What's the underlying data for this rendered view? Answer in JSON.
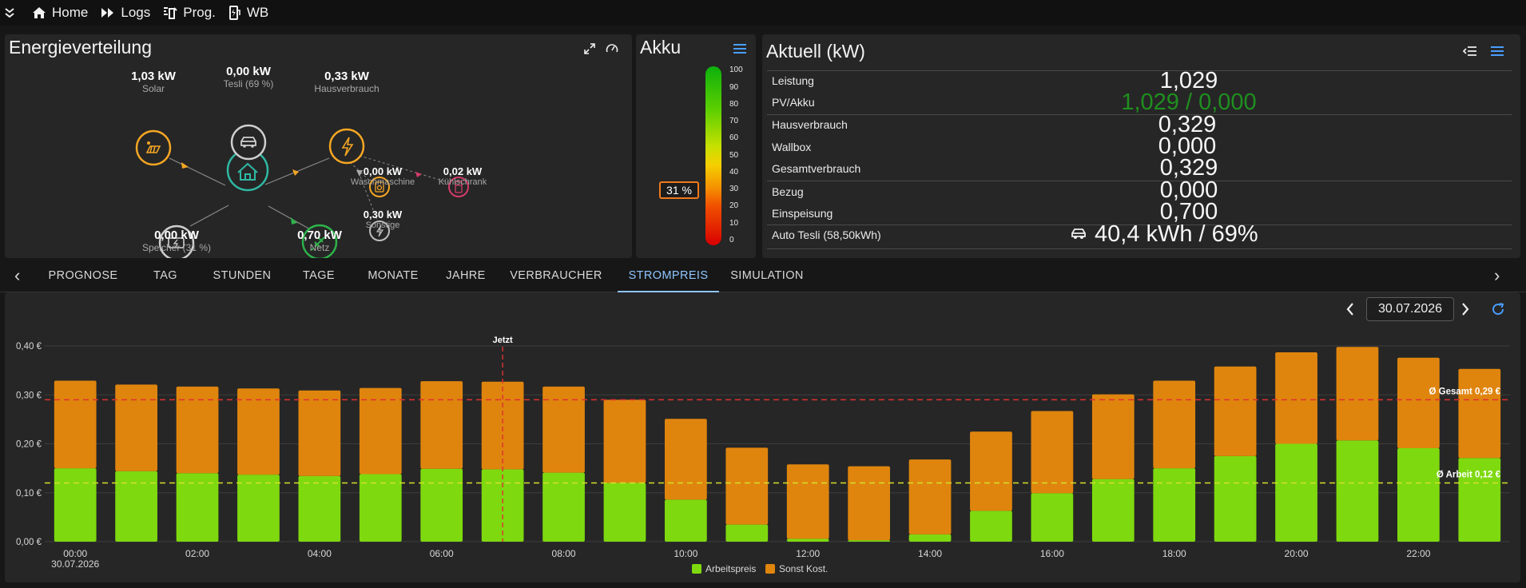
{
  "nav": {
    "items": [
      {
        "label": "Home",
        "icon": "home-icon"
      },
      {
        "label": "Logs",
        "icon": "fast-forward-icon"
      },
      {
        "label": "Prog.",
        "icon": "program-icon"
      },
      {
        "label": "WB",
        "icon": "wallbox-icon"
      }
    ]
  },
  "energy": {
    "title": "Energieverteilung",
    "solar": {
      "value": "1,03 kW",
      "label": "Solar"
    },
    "tesli": {
      "value": "0,00 kW",
      "label": "Tesli (69 %)"
    },
    "haus": {
      "value": "0,33 kW",
      "label": "Hausverbrauch"
    },
    "speicher": {
      "value": "0,00 kW",
      "label": "Speicher (31 %)"
    },
    "netz": {
      "value": "0,70 kW",
      "label": "Netz"
    },
    "wasch": {
      "value": "0,00 kW",
      "label": "Waschmaschine"
    },
    "kuehl": {
      "value": "0,02 kW",
      "label": "Kühlschrank"
    },
    "sonstige": {
      "value": "0,30 kW",
      "label": "Sonstige"
    }
  },
  "akku": {
    "title": "Akku",
    "level": 31,
    "level_label": "31 %",
    "scale": [
      "100",
      "90",
      "80",
      "70",
      "60",
      "50",
      "40",
      "30",
      "20",
      "10",
      "0"
    ]
  },
  "aktuell": {
    "title": "Aktuell (kW)",
    "rows": [
      {
        "label": "Leistung",
        "value": "1,029"
      },
      {
        "label": "PV/Akku",
        "value": "1,029 / 0,000"
      },
      {
        "label": "Hausverbrauch",
        "value": "0,329"
      },
      {
        "label": "Wallbox",
        "value": "0,000"
      },
      {
        "label": "Gesamtverbrauch",
        "value": "0,329"
      },
      {
        "label": "Bezug",
        "value": "0,000"
      },
      {
        "label": "Einspeisung",
        "value": "0,700"
      },
      {
        "label": "Auto Tesli (58,50kWh)",
        "value": "40,4 kWh / 69%"
      }
    ],
    "colors": {
      "pv": "#1f8f1f"
    }
  },
  "tabs": {
    "items": [
      "PROGNOSE",
      "TAG",
      "STUNDEN",
      "TAGE",
      "MONATE",
      "JAHRE",
      "VERBRAUCHER",
      "STROMPREIS",
      "SIMULATION"
    ],
    "active": "STROMPREIS"
  },
  "chart_toolbar": {
    "date": "30.07.2026"
  },
  "chart_data": {
    "type": "bar",
    "stacked": true,
    "categories": [
      "00:00",
      "01:00",
      "02:00",
      "03:00",
      "04:00",
      "05:00",
      "06:00",
      "07:00",
      "08:00",
      "09:00",
      "10:00",
      "11:00",
      "12:00",
      "13:00",
      "14:00",
      "15:00",
      "16:00",
      "17:00",
      "18:00",
      "19:00",
      "20:00",
      "21:00",
      "22:00",
      "23:00"
    ],
    "xtick_labels": [
      "00:00",
      "",
      "02:00",
      "",
      "04:00",
      "",
      "06:00",
      "",
      "08:00",
      "",
      "10:00",
      "",
      "12:00",
      "",
      "14:00",
      "",
      "16:00",
      "",
      "18:00",
      "",
      "20:00",
      "",
      "22:00",
      ""
    ],
    "x_date_label": "30.07.2026",
    "series": [
      {
        "name": "Arbeitspreis",
        "color": "#7ed90f",
        "values": [
          0.15,
          0.144,
          0.14,
          0.137,
          0.134,
          0.138,
          0.149,
          0.148,
          0.141,
          0.12,
          0.086,
          0.035,
          0.006,
          0.003,
          0.015,
          0.063,
          0.099,
          0.128,
          0.15,
          0.175,
          0.2,
          0.207,
          0.191,
          0.171
        ]
      },
      {
        "name": "Sonst Kost.",
        "color": "#df850e",
        "values": [
          0.179,
          0.177,
          0.177,
          0.176,
          0.175,
          0.176,
          0.179,
          0.179,
          0.176,
          0.17,
          0.165,
          0.157,
          0.152,
          0.151,
          0.153,
          0.162,
          0.168,
          0.173,
          0.179,
          0.183,
          0.187,
          0.191,
          0.185,
          0.182
        ]
      }
    ],
    "ylim": [
      0,
      0.4
    ],
    "yticks": [
      "0,00 €",
      "0,10 €",
      "0,20 €",
      "0,30 €",
      "0,40 €"
    ],
    "lines": [
      {
        "label": "Ø Gesamt 0,29 €",
        "value": 0.29,
        "color": "#e03030"
      },
      {
        "label": "Ø Arbeit 0,12 €",
        "value": 0.12,
        "color": "#d6e02a"
      }
    ],
    "now_marker": {
      "label": "Jetzt",
      "hour": 7.0,
      "color": "#e03030"
    },
    "legend_position": "bottom"
  }
}
